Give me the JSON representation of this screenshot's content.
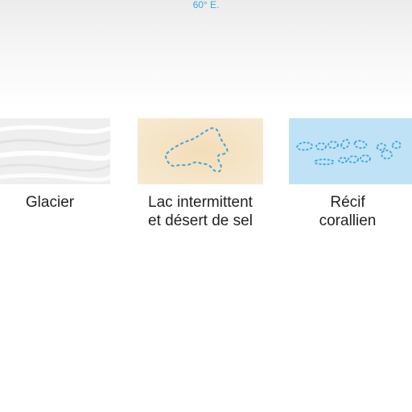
{
  "map": {
    "meridian_label": "60° E."
  },
  "legend": {
    "items": [
      {
        "lines": [
          "Glacier"
        ],
        "symbol": "glacier-texture",
        "color": "#eeeeee"
      },
      {
        "lines": [
          "Lac intermittent",
          "et désert de sel"
        ],
        "symbol": "dashed-outline-on-sand",
        "color": "#f4e3c4",
        "line_color": "#3ea6d6"
      },
      {
        "lines": [
          "Récif",
          "corallien"
        ],
        "symbol": "reef-outlines-on-water",
        "color": "#bfe2f6",
        "line_color": "#3ea6d6"
      }
    ]
  }
}
